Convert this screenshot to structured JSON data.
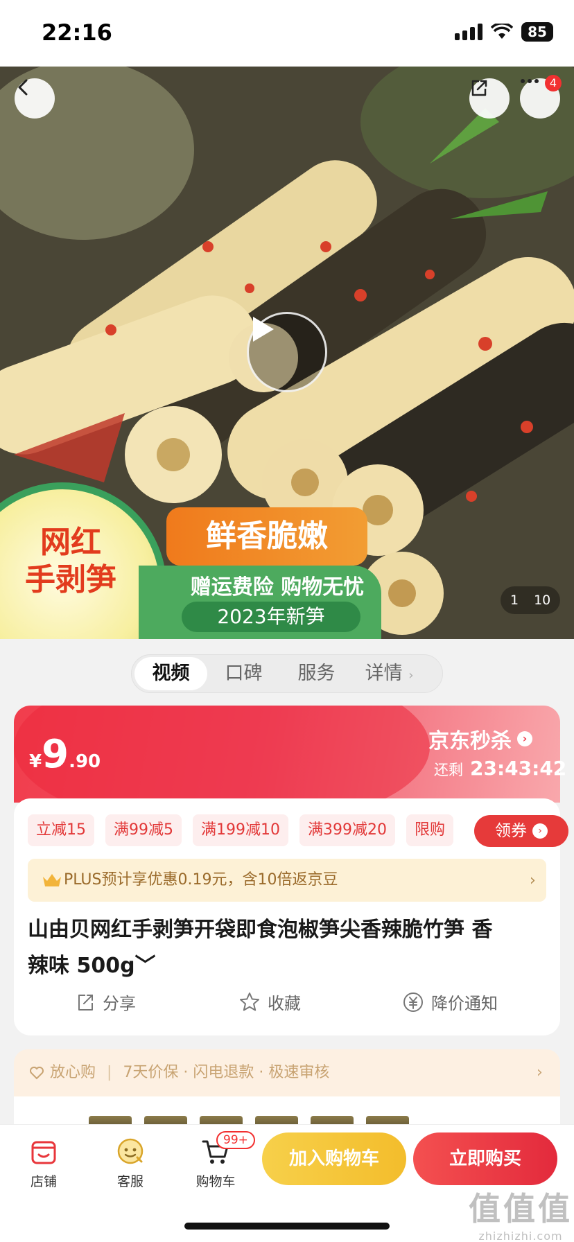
{
  "status_bar": {
    "time": "22:16",
    "battery": "85"
  },
  "header": {
    "more_badge": "4"
  },
  "hero": {
    "image_counter": {
      "current": "1",
      "total": "10"
    },
    "promo": {
      "title_line1": "网红",
      "title_line2": "手剥笋",
      "banner": "鲜香脆嫩",
      "subtitle": "赠运费险 购物无忧",
      "year_tag": "2023年新笋"
    }
  },
  "tabs": [
    {
      "label": "视频"
    },
    {
      "label": "口碑"
    },
    {
      "label": "服务"
    },
    {
      "label": "详情"
    }
  ],
  "price": {
    "currency": "¥",
    "integer": "9",
    "decimal": ".90",
    "seckill_label": "京东秒杀",
    "countdown_label": "还剩",
    "countdown": "23:43:42"
  },
  "coupons": [
    "立减15",
    "满99减5",
    "满199减10",
    "满399减20",
    "限购"
  ],
  "get_coupon_label": "领券",
  "plus_text": "PLUS预计享优惠0.19元，含10倍返京豆",
  "product": {
    "title_line1": "山由贝网红手剥笋开袋即食泡椒笋尖香辣脆竹笋 香",
    "title_line2": "辣味 500g﹀"
  },
  "actions": [
    {
      "label": "分享",
      "icon": "share-icon"
    },
    {
      "label": "收藏",
      "icon": "star-icon"
    },
    {
      "label": "降价通知",
      "icon": "price-drop-icon"
    }
  ],
  "assurance": {
    "label": "放心购",
    "items": "7天价保 · 闪电退款 · 极速审核"
  },
  "bottom_nav": [
    {
      "label": "店铺",
      "icon": "store-icon"
    },
    {
      "label": "客服",
      "icon": "customer-service-icon"
    },
    {
      "label": "购物车",
      "icon": "cart-icon"
    }
  ],
  "cart_badge": "99+",
  "buttons": {
    "add_to_cart": "加入购物车",
    "buy_now": "立即购买"
  },
  "watermark": {
    "big": "值值值",
    "small": "zhizhizhi.com"
  },
  "colors": {
    "accent_red": "#e63a3a",
    "add_cart_yellow": "#f3bd2c",
    "promo_green": "#4daa5e"
  }
}
